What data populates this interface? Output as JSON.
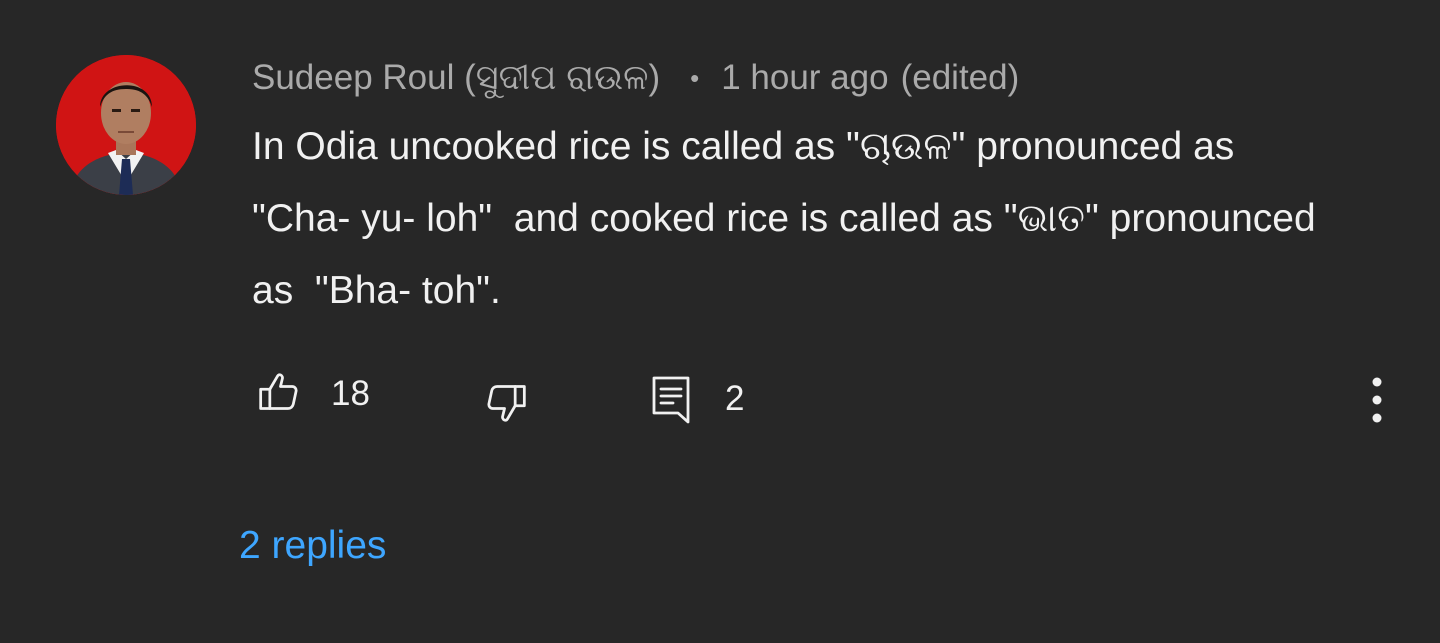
{
  "comment": {
    "author": "Sudeep Roul (ସୁଦୀପ ରାଉଳ)",
    "separator": "•",
    "timestamp": "1 hour ago",
    "edited_label": "(edited)",
    "text": "In Odia uncooked rice is called as \"ଚାଉଳ\" pronounced as \"Cha- yu- loh\"  and cooked rice is called as \"ଭାତ\" pronounced as  \"Bha- toh\".",
    "avatar_icon": "profile-photo-avatar",
    "avatar_bg": "#d01414"
  },
  "actions": {
    "like_icon": "thumbs-up-icon",
    "like_count": "18",
    "dislike_icon": "thumbs-down-icon",
    "reply_icon": "comment-reply-icon",
    "reply_count": "2",
    "more_icon": "more-vertical-icon"
  },
  "replies": {
    "link_label": "2 replies",
    "link_color": "#3ea6ff"
  }
}
